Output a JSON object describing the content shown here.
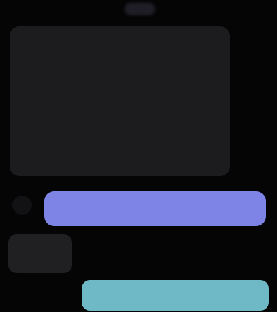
{
  "status": {
    "indicator": ""
  },
  "message_card": {
    "lines": [
      "",
      "",
      "",
      "",
      "",
      "",
      "",
      "",
      ""
    ]
  },
  "actions": {
    "primary_label": "",
    "secondary_label": ""
  },
  "side_bubble": {
    "text": ""
  },
  "colors": {
    "background": "#050506",
    "card": "#1c1c1f",
    "primary_accent": "#7e83e6",
    "secondary_accent": "#6fb8c6"
  }
}
